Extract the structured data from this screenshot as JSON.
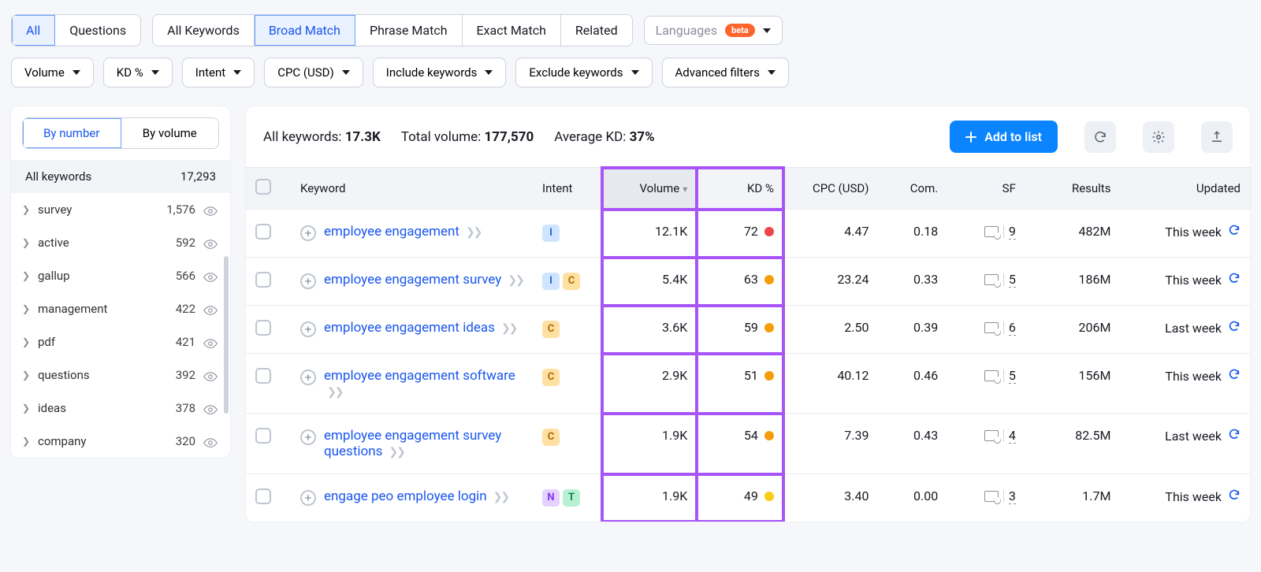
{
  "tabs_primary": {
    "all": "All",
    "questions": "Questions"
  },
  "tabs_match": {
    "all_kw": "All Keywords",
    "broad": "Broad Match",
    "phrase": "Phrase Match",
    "exact": "Exact Match",
    "related": "Related"
  },
  "languages": {
    "label": "Languages",
    "badge": "beta"
  },
  "filters": {
    "volume": "Volume",
    "kd": "KD %",
    "intent": "Intent",
    "cpc": "CPC (USD)",
    "include": "Include keywords",
    "exclude": "Exclude keywords",
    "advanced": "Advanced filters"
  },
  "sidebar": {
    "tabs": {
      "by_number": "By number",
      "by_volume": "By volume"
    },
    "total_label": "All keywords",
    "total_count": "17,293",
    "items": [
      {
        "label": "survey",
        "count": "1,576"
      },
      {
        "label": "active",
        "count": "592"
      },
      {
        "label": "gallup",
        "count": "566"
      },
      {
        "label": "management",
        "count": "422"
      },
      {
        "label": "pdf",
        "count": "421"
      },
      {
        "label": "questions",
        "count": "392"
      },
      {
        "label": "ideas",
        "count": "378"
      },
      {
        "label": "company",
        "count": "320"
      }
    ]
  },
  "stats": {
    "all_kw_label": "All keywords: ",
    "all_kw_value": "17.3K",
    "total_vol_label": "Total volume: ",
    "total_vol_value": "177,570",
    "avg_kd_label": "Average KD: ",
    "avg_kd_value": "37%"
  },
  "actions": {
    "add": "Add to list"
  },
  "headers": {
    "keyword": "Keyword",
    "intent": "Intent",
    "volume": "Volume",
    "kd": "KD %",
    "cpc": "CPC (USD)",
    "com": "Com.",
    "sf": "SF",
    "results": "Results",
    "updated": "Updated"
  },
  "rows": [
    {
      "keyword": "employee engagement",
      "intent": [
        "I"
      ],
      "volume": "12.1K",
      "kd": "72",
      "kd_color": "#ef4444",
      "cpc": "4.47",
      "com": "0.18",
      "sf": "9",
      "results": "482M",
      "updated": "This week"
    },
    {
      "keyword": "employee engagement survey",
      "intent": [
        "I",
        "C"
      ],
      "volume": "5.4K",
      "kd": "63",
      "kd_color": "#f59e0b",
      "cpc": "23.24",
      "com": "0.33",
      "sf": "5",
      "results": "186M",
      "updated": "This week"
    },
    {
      "keyword": "employee engagement ideas",
      "intent": [
        "C"
      ],
      "volume": "3.6K",
      "kd": "59",
      "kd_color": "#f59e0b",
      "cpc": "2.50",
      "com": "0.39",
      "sf": "6",
      "results": "206M",
      "updated": "Last week"
    },
    {
      "keyword": "employee engagement software",
      "intent": [
        "C"
      ],
      "volume": "2.9K",
      "kd": "51",
      "kd_color": "#f59e0b",
      "cpc": "40.12",
      "com": "0.46",
      "sf": "5",
      "results": "156M",
      "updated": "This week"
    },
    {
      "keyword": "employee engagement survey questions",
      "intent": [
        "C"
      ],
      "volume": "1.9K",
      "kd": "54",
      "kd_color": "#f59e0b",
      "cpc": "7.39",
      "com": "0.43",
      "sf": "4",
      "results": "82.5M",
      "updated": "Last week"
    },
    {
      "keyword": "engage peo employee login",
      "intent": [
        "N",
        "T"
      ],
      "volume": "1.9K",
      "kd": "49",
      "kd_color": "#facc15",
      "cpc": "3.40",
      "com": "0.00",
      "sf": "3",
      "results": "1.7M",
      "updated": "This week"
    }
  ]
}
